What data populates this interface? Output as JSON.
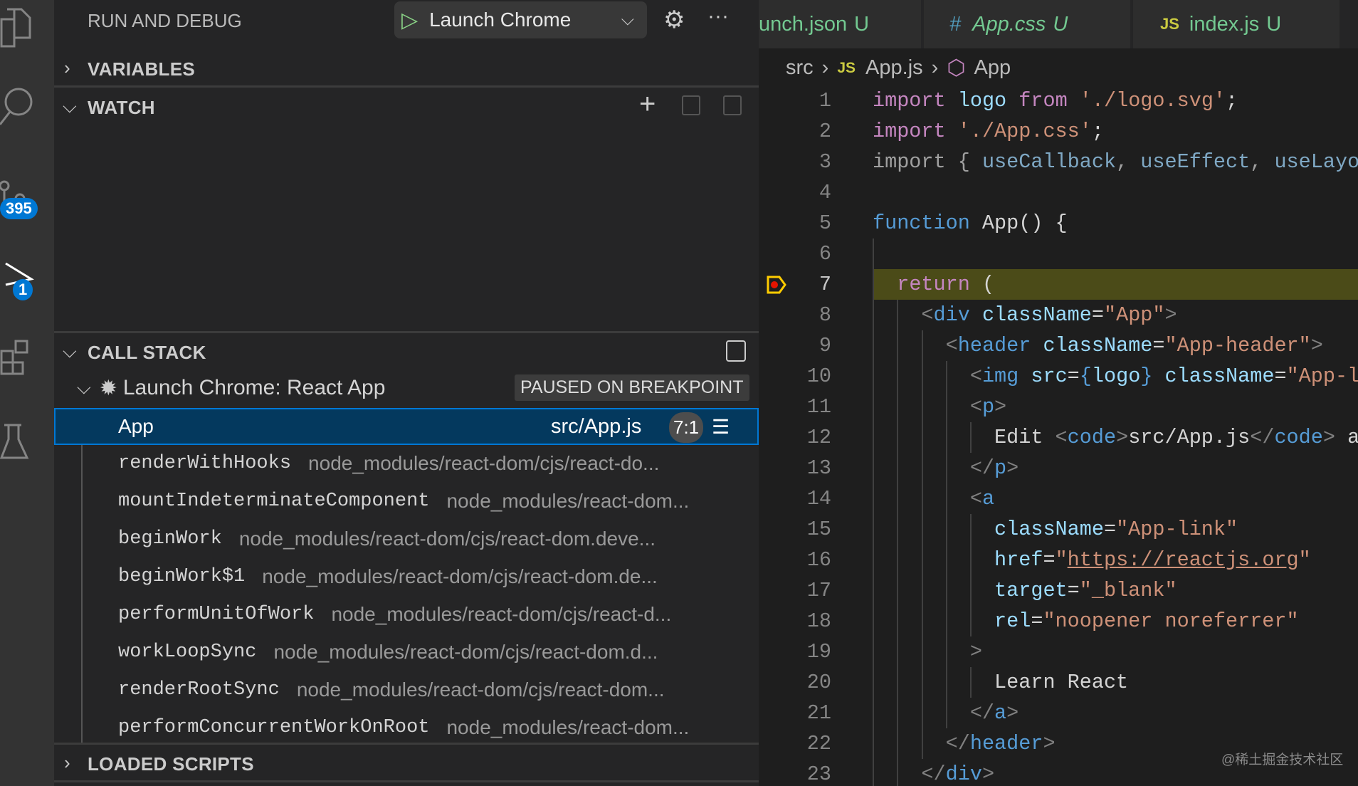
{
  "activity_bar": {
    "items": [
      {
        "icon": "files-icon"
      },
      {
        "icon": "search-icon"
      },
      {
        "icon": "source-control-icon",
        "badge": "395"
      },
      {
        "icon": "run-debug-icon",
        "badge": "1"
      },
      {
        "icon": "extensions-icon"
      },
      {
        "icon": "testing-icon"
      }
    ]
  },
  "sidebar": {
    "title": "RUN AND DEBUG",
    "config": "Launch Chrome",
    "sections": {
      "variables": "VARIABLES",
      "watch": "WATCH",
      "call_stack": "CALL STACK",
      "loaded_scripts": "LOADED SCRIPTS"
    },
    "session": {
      "name": "Launch Chrome: React App",
      "status": "PAUSED ON BREAKPOINT"
    },
    "selected_frame": {
      "name": "App",
      "file": "src/App.js",
      "position": "7:1"
    },
    "frames": [
      {
        "name": "renderWithHooks",
        "path": "node_modules/react-dom/cjs/react-do..."
      },
      {
        "name": "mountIndeterminateComponent",
        "path": "node_modules/react-dom..."
      },
      {
        "name": "beginWork",
        "path": "node_modules/react-dom/cjs/react-dom.deve..."
      },
      {
        "name": "beginWork$1",
        "path": "node_modules/react-dom/cjs/react-dom.de..."
      },
      {
        "name": "performUnitOfWork",
        "path": "node_modules/react-dom/cjs/react-d..."
      },
      {
        "name": "workLoopSync",
        "path": "node_modules/react-dom/cjs/react-dom.d..."
      },
      {
        "name": "renderRootSync",
        "path": "node_modules/react-dom/cjs/react-dom..."
      },
      {
        "name": "performConcurrentWorkOnRoot",
        "path": "node_modules/react-dom..."
      }
    ]
  },
  "editor": {
    "tabs": [
      {
        "icon": "",
        "label": "unch.json",
        "status": "U"
      },
      {
        "icon": "#",
        "label": "App.css",
        "status": "U"
      },
      {
        "icon": "JS",
        "label": "index.js",
        "status": "U"
      }
    ],
    "breadcrumb": {
      "folder": "src",
      "file_icon": "JS",
      "file": "App.js",
      "symbol": "App"
    },
    "current_line": 7,
    "lines": [
      [
        [
          "kw",
          "import"
        ],
        [
          "txt",
          " "
        ],
        [
          "var",
          "logo"
        ],
        [
          "txt",
          " "
        ],
        [
          "kw",
          "from"
        ],
        [
          "txt",
          " "
        ],
        [
          "str",
          "'./logo.svg'"
        ],
        [
          "txt",
          ";"
        ]
      ],
      [
        [
          "kw",
          "import"
        ],
        [
          "txt",
          " "
        ],
        [
          "str",
          "'./App.css'"
        ],
        [
          "txt",
          ";"
        ]
      ],
      [
        [
          "dim",
          "import { "
        ],
        [
          "dimv",
          "useCallback"
        ],
        [
          "dim",
          ", "
        ],
        [
          "dimv",
          "useEffect"
        ],
        [
          "dim",
          ", "
        ],
        [
          "dimv",
          "useLayoutEffect"
        ]
      ],
      [],
      [
        [
          "fnk",
          "function"
        ],
        [
          "txt",
          " App() {"
        ]
      ],
      [],
      [
        [
          "txt",
          "  "
        ],
        [
          "kw",
          "return"
        ],
        [
          "txt",
          " ("
        ]
      ],
      [
        [
          "txt",
          "    "
        ],
        [
          "pun",
          "<"
        ],
        [
          "tag",
          "div"
        ],
        [
          "txt",
          " "
        ],
        [
          "var",
          "className"
        ],
        [
          "txt",
          "="
        ],
        [
          "str",
          "\"App\""
        ],
        [
          "pun",
          ">"
        ]
      ],
      [
        [
          "txt",
          "      "
        ],
        [
          "pun",
          "<"
        ],
        [
          "tag",
          "header"
        ],
        [
          "txt",
          " "
        ],
        [
          "var",
          "className"
        ],
        [
          "txt",
          "="
        ],
        [
          "str",
          "\"App-header\""
        ],
        [
          "pun",
          ">"
        ]
      ],
      [
        [
          "txt",
          "        "
        ],
        [
          "pun",
          "<"
        ],
        [
          "tag",
          "img"
        ],
        [
          "txt",
          " "
        ],
        [
          "var",
          "src"
        ],
        [
          "txt",
          "="
        ],
        [
          "tag",
          "{"
        ],
        [
          "var",
          "logo"
        ],
        [
          "tag",
          "}"
        ],
        [
          "txt",
          " "
        ],
        [
          "var",
          "className"
        ],
        [
          "txt",
          "="
        ],
        [
          "str",
          "\"App-logo\""
        ]
      ],
      [
        [
          "txt",
          "        "
        ],
        [
          "pun",
          "<"
        ],
        [
          "tag",
          "p"
        ],
        [
          "pun",
          ">"
        ]
      ],
      [
        [
          "txt",
          "          Edit "
        ],
        [
          "pun",
          "<"
        ],
        [
          "tag",
          "code"
        ],
        [
          "pun",
          ">"
        ],
        [
          "txt",
          "src/App.js"
        ],
        [
          "pun",
          "</"
        ],
        [
          "tag",
          "code"
        ],
        [
          "pun",
          ">"
        ],
        [
          "txt",
          " and save"
        ]
      ],
      [
        [
          "txt",
          "        "
        ],
        [
          "pun",
          "</"
        ],
        [
          "tag",
          "p"
        ],
        [
          "pun",
          ">"
        ]
      ],
      [
        [
          "txt",
          "        "
        ],
        [
          "pun",
          "<"
        ],
        [
          "tag",
          "a"
        ]
      ],
      [
        [
          "txt",
          "          "
        ],
        [
          "var",
          "className"
        ],
        [
          "txt",
          "="
        ],
        [
          "str",
          "\"App-link\""
        ]
      ],
      [
        [
          "txt",
          "          "
        ],
        [
          "var",
          "href"
        ],
        [
          "txt",
          "="
        ],
        [
          "str",
          "\""
        ],
        [
          "url",
          "https://reactjs.org"
        ],
        [
          "str",
          "\""
        ]
      ],
      [
        [
          "txt",
          "          "
        ],
        [
          "var",
          "target"
        ],
        [
          "txt",
          "="
        ],
        [
          "str",
          "\"_blank\""
        ]
      ],
      [
        [
          "txt",
          "          "
        ],
        [
          "var",
          "rel"
        ],
        [
          "txt",
          "="
        ],
        [
          "str",
          "\"noopener noreferrer\""
        ]
      ],
      [
        [
          "txt",
          "        "
        ],
        [
          "pun",
          ">"
        ]
      ],
      [
        [
          "txt",
          "          Learn React"
        ]
      ],
      [
        [
          "txt",
          "        "
        ],
        [
          "pun",
          "</"
        ],
        [
          "tag",
          "a"
        ],
        [
          "pun",
          ">"
        ]
      ],
      [
        [
          "txt",
          "      "
        ],
        [
          "pun",
          "</"
        ],
        [
          "tag",
          "header"
        ],
        [
          "pun",
          ">"
        ]
      ],
      [
        [
          "txt",
          "    "
        ],
        [
          "pun",
          "</"
        ],
        [
          "tag",
          "div"
        ],
        [
          "pun",
          ">"
        ]
      ]
    ]
  },
  "watermark": "@稀土掘金技术社区",
  "colors": {
    "accent": "#0078d4",
    "selection": "#04395e",
    "current_line_bg": "#4b4b18",
    "breakpoint": "#e51400",
    "uncommitted": "#73c991"
  }
}
